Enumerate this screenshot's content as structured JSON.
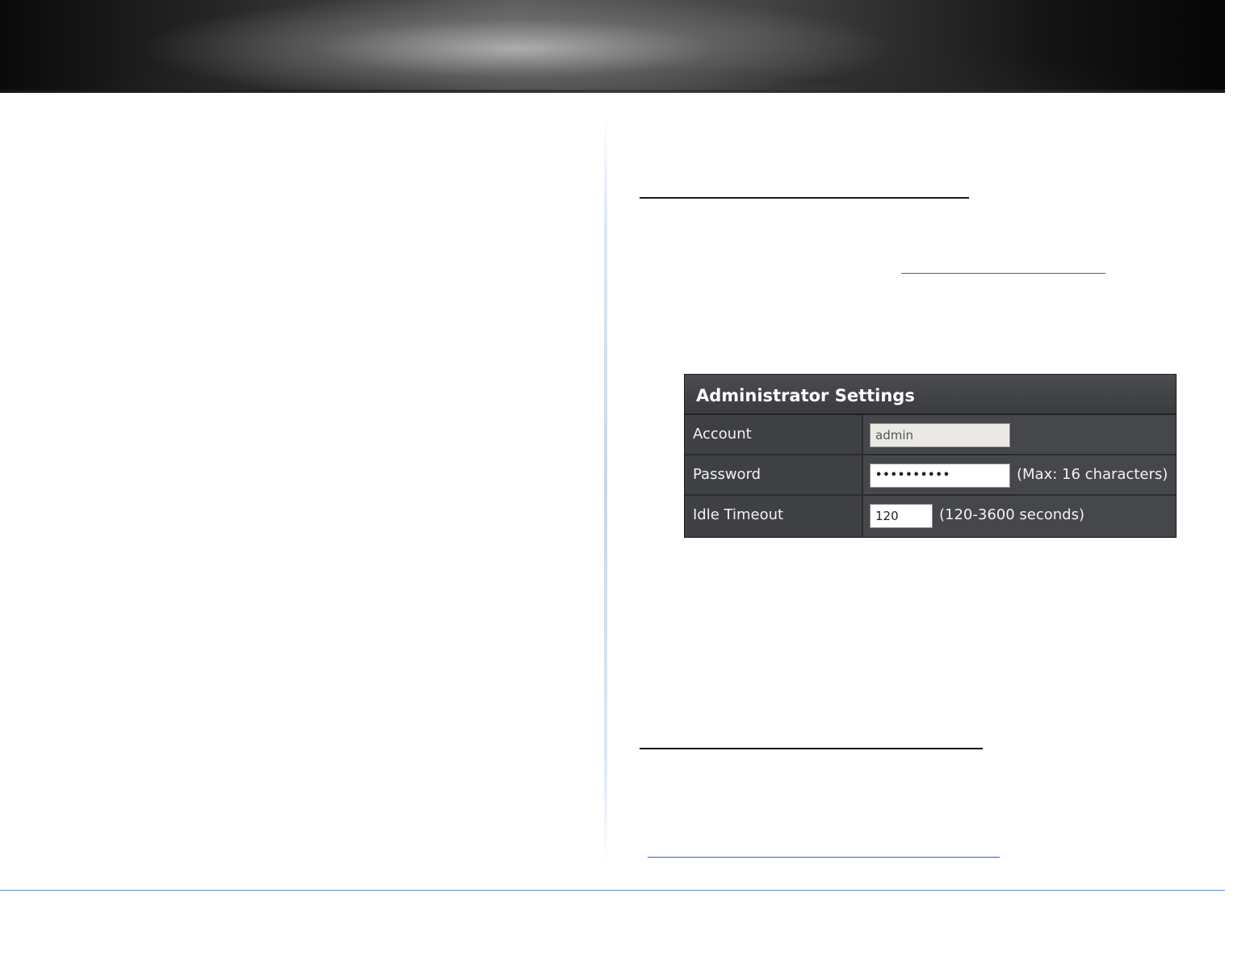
{
  "admin_settings": {
    "title": "Administrator Settings",
    "rows": [
      {
        "label": "Account",
        "value": "admin"
      },
      {
        "label": "Password",
        "value": "••••••••••",
        "hint": "(Max: 16 characters)"
      },
      {
        "label": "Idle Timeout",
        "value": "120",
        "hint": "(120-3600 seconds)"
      }
    ]
  },
  "colors": {
    "panel_background": "#3c3e42",
    "link_underline": "#2b5fd9",
    "footer_rule": "#5b8ed6"
  }
}
